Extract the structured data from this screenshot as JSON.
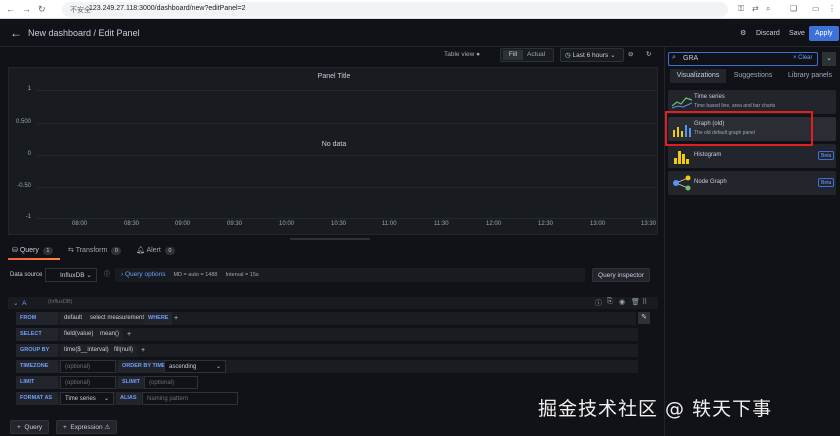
{
  "browser": {
    "back_icon": "arrow-left",
    "forward_icon": "arrow-right",
    "reload_icon": "reload",
    "security_label": "不安全",
    "url": "123.249.27.118:3000/dashboard/new?editPanel=2"
  },
  "header": {
    "title": "New dashboard / Edit Panel",
    "discard": "Discard",
    "save": "Save",
    "apply": "Apply"
  },
  "toolbar": {
    "table_view": "Table view",
    "fill": "Fill",
    "actual": "Actual",
    "time_range": "Last 6 hours"
  },
  "panel": {
    "title": "Panel Title",
    "no_data": "No data",
    "y_ticks": [
      "1",
      "0.500",
      "0",
      "-0.50",
      "-1"
    ],
    "x_ticks": [
      "08:00",
      "08:30",
      "09:00",
      "09:30",
      "10:00",
      "10:30",
      "11:00",
      "11:30",
      "12:00",
      "12:30",
      "13:00",
      "13:30"
    ]
  },
  "tabs": [
    {
      "label": "Query",
      "count": "1"
    },
    {
      "label": "Transform",
      "count": "0"
    },
    {
      "label": "Alert",
      "count": "0"
    }
  ],
  "datasource": {
    "label": "Data source",
    "name": "InfluxDB",
    "query_options": "Query options",
    "md": "MD = auto = 1488",
    "interval": "Interval = 15s",
    "inspector": "Query inspector"
  },
  "query": {
    "ref": "A",
    "ds_hint": "(InfluxDB)",
    "from_kw": "FROM",
    "from_policy": "default",
    "from_measurement": "select measurement",
    "where_kw": "WHERE",
    "select_kw": "SELECT",
    "select_field": "field(value)",
    "select_mean": "mean()",
    "groupby_kw": "GROUP BY",
    "groupby_time": "time($__interval)",
    "groupby_fill": "fill(null)",
    "timezone_kw": "TIMEZONE",
    "timezone_ph": "(optional)",
    "orderby_kw": "ORDER BY TIME",
    "orderby_val": "ascending",
    "limit_kw": "LIMIT",
    "limit_ph": "(optional)",
    "slimit_kw": "SLIMIT",
    "slimit_ph": "(optional)",
    "format_kw": "FORMAT AS",
    "format_val": "Time series",
    "alias_kw": "ALIAS",
    "alias_ph": "Naming pattern",
    "plus": "+"
  },
  "bottom": {
    "add_query": "Query",
    "add_expression": "Expression"
  },
  "viz": {
    "search_value": "GRA",
    "clear": "Clear",
    "tabs": [
      "Visualizations",
      "Suggestions",
      "Library panels"
    ],
    "items": [
      {
        "name": "Time series",
        "desc": "Time based line, area and bar charts",
        "icon": "time-series-icon"
      },
      {
        "name": "Graph (old)",
        "desc": "The old default graph panel",
        "icon": "graph-old-icon"
      },
      {
        "name": "Histogram",
        "desc": "",
        "beta": "Beta",
        "icon": "histogram-icon"
      },
      {
        "name": "Node Graph",
        "desc": "",
        "beta": "Beta",
        "icon": "node-graph-icon"
      }
    ]
  },
  "watermark": "掘金技术社区 @ 轶天下事",
  "colors": {
    "accent": "#3d71d9",
    "highlight": "#e02020",
    "tab_active": "#ff8833"
  }
}
